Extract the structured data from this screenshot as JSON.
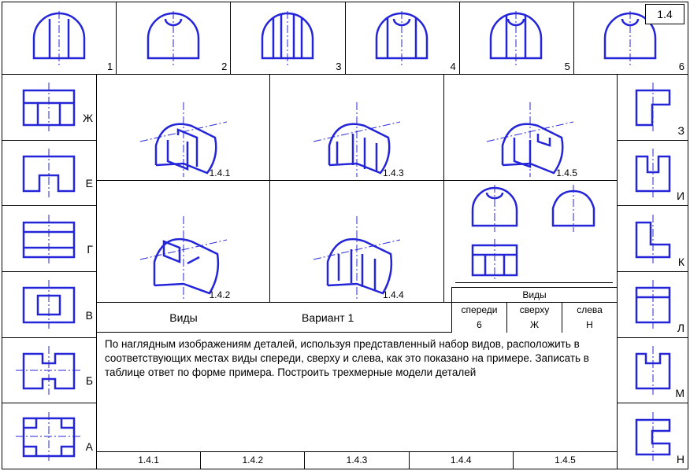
{
  "badge": "1.4",
  "top_numbers": [
    "1",
    "2",
    "3",
    "4",
    "5",
    "6"
  ],
  "left_labels": [
    "Ж",
    "Е",
    "Г",
    "В",
    "Б",
    "А"
  ],
  "right_labels": [
    "З",
    "И",
    "К",
    "Л",
    "М",
    "Н"
  ],
  "iso_labels_row1": [
    "1.4.1",
    "1.4.3",
    "1.4.5"
  ],
  "iso_labels_row2": [
    "1.4.2",
    "1.4.4",
    ""
  ],
  "answer": {
    "views_title": "Виды",
    "variant_title": "Вариант 1",
    "table_header": "Виды",
    "cols": [
      "спереди",
      "сверху",
      "слева"
    ],
    "vals": [
      "6",
      "Ж",
      "Н"
    ]
  },
  "instructions": "По наглядным изображениям деталей, используя представленный набор видов, расположить в соответствующих местах виды спереди, сверху и слева, как это показано на примере. Записать в таблице ответ по форме  примера. Построить трехмерные модели деталей",
  "bottom_cells": [
    "1.4.1",
    "1.4.2",
    "1.4.3",
    "1.4.4",
    "1.4.5"
  ]
}
